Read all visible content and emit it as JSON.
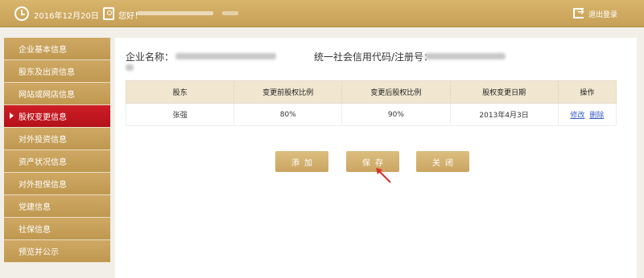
{
  "topbar": {
    "date": "2016年12月20日",
    "greeting": "您好！",
    "logout_label": "退出登录"
  },
  "sidebar": {
    "items": [
      {
        "label": "企业基本信息"
      },
      {
        "label": "股东及出资信息"
      },
      {
        "label": "网站或网店信息"
      },
      {
        "label": "股权变更信息"
      },
      {
        "label": "对外投资信息"
      },
      {
        "label": "资产状况信息"
      },
      {
        "label": "对外担保信息"
      },
      {
        "label": "党建信息"
      },
      {
        "label": "社保信息"
      },
      {
        "label": "预览并公示"
      }
    ],
    "active_index": 3
  },
  "main": {
    "company_name_label": "企业名称：",
    "credit_code_label": "统一社会信用代码/注册号：",
    "table": {
      "headers": [
        "股东",
        "变更前股权比例",
        "变更后股权比例",
        "股权变更日期",
        "操作"
      ],
      "rows": [
        {
          "shareholder": "张强",
          "before": "80%",
          "after": "90%",
          "date": "2013年4月3日",
          "edit": "修改",
          "delete": "删除"
        }
      ]
    },
    "buttons": {
      "add": "添加",
      "save": "保存",
      "close": "关闭"
    }
  },
  "colors": {
    "gold": "#c7a057",
    "active_red": "#c4141d",
    "link_blue": "#3a5fc9"
  }
}
